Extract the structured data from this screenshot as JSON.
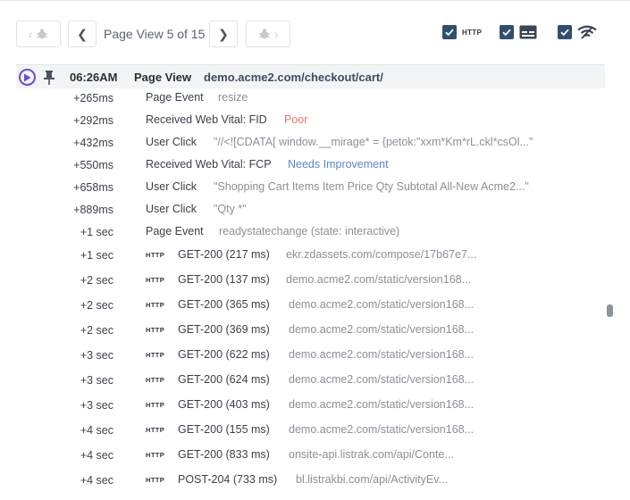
{
  "toolbar": {
    "page_label": "Page View 5 of 15",
    "filters": [
      {
        "name": "http",
        "label": "HTTP",
        "checked": true
      },
      {
        "name": "console",
        "checked": true
      },
      {
        "name": "network",
        "checked": true
      }
    ]
  },
  "page_view": {
    "time": "06:26AM",
    "label": "Page View",
    "url": "demo.acme2.com/checkout/cart/"
  },
  "events": [
    {
      "time": "+265ms",
      "label": "Page Event",
      "value": "resize",
      "style": "muted"
    },
    {
      "time": "+292ms",
      "label": "Received Web Vital: FID",
      "value": "Poor",
      "style": "poor"
    },
    {
      "time": "+432ms",
      "label": "User Click",
      "value": "\"//<![CDATA[ window.__mirage* = {petok:\"xxm*Km*rL.ckl*csOl...\"",
      "style": "muted"
    },
    {
      "time": "+550ms",
      "label": "Received Web Vital: FCP",
      "value": "Needs Improvement",
      "style": "improve"
    },
    {
      "time": "+658ms",
      "label": "User Click",
      "value": "\"Shopping Cart Items Item Price Qty Subtotal All-New Acme2...\"",
      "style": "muted"
    },
    {
      "time": "+889ms",
      "label": "User Click",
      "value": "\"Qty *\"",
      "style": "muted"
    },
    {
      "time": "+1 sec",
      "label": "Page Event",
      "value": "readystatechange (state: interactive)",
      "style": "muted"
    }
  ],
  "requests": [
    {
      "time": "+1 sec",
      "tag": "HTTP",
      "status": "GET-200 (217 ms)",
      "url": "ekr.zdassets.com/compose/17b67e7..."
    },
    {
      "time": "+2 sec",
      "tag": "HTTP",
      "status": "GET-200 (137 ms)",
      "url": "demo.acme2.com/static/version168..."
    },
    {
      "time": "+2 sec",
      "tag": "HTTP",
      "status": "GET-200 (365 ms)",
      "url": "demo.acme2.com/static/version168..."
    },
    {
      "time": "+2 sec",
      "tag": "HTTP",
      "status": "GET-200 (369 ms)",
      "url": "demo.acme2.com/static/version168..."
    },
    {
      "time": "+3 sec",
      "tag": "HTTP",
      "status": "GET-200 (622 ms)",
      "url": "demo.acme2.com/static/version168..."
    },
    {
      "time": "+3 sec",
      "tag": "HTTP",
      "status": "GET-200 (624 ms)",
      "url": "demo.acme2.com/static/version168..."
    },
    {
      "time": "+3 sec",
      "tag": "HTTP",
      "status": "GET-200 (403 ms)",
      "url": "demo.acme2.com/static/version168..."
    },
    {
      "time": "+4 sec",
      "tag": "HTTP",
      "status": "GET-200 (155 ms)",
      "url": "demo.acme2.com/static/version168..."
    },
    {
      "time": "+4 sec",
      "tag": "HTTP",
      "status": "GET-200 (833 ms)",
      "url": "onsite-api.listrak.com/api/Conte..."
    },
    {
      "time": "+4 sec",
      "tag": "HTTP",
      "status": "POST-204 (733 ms)",
      "url": "bl.listrakbi.com/api/ActivityEv..."
    }
  ],
  "colors": {
    "accent": "#6c4bd1",
    "checkbox": "#2f4f6f",
    "poor": "#e07868",
    "improve": "#5a86d6"
  }
}
